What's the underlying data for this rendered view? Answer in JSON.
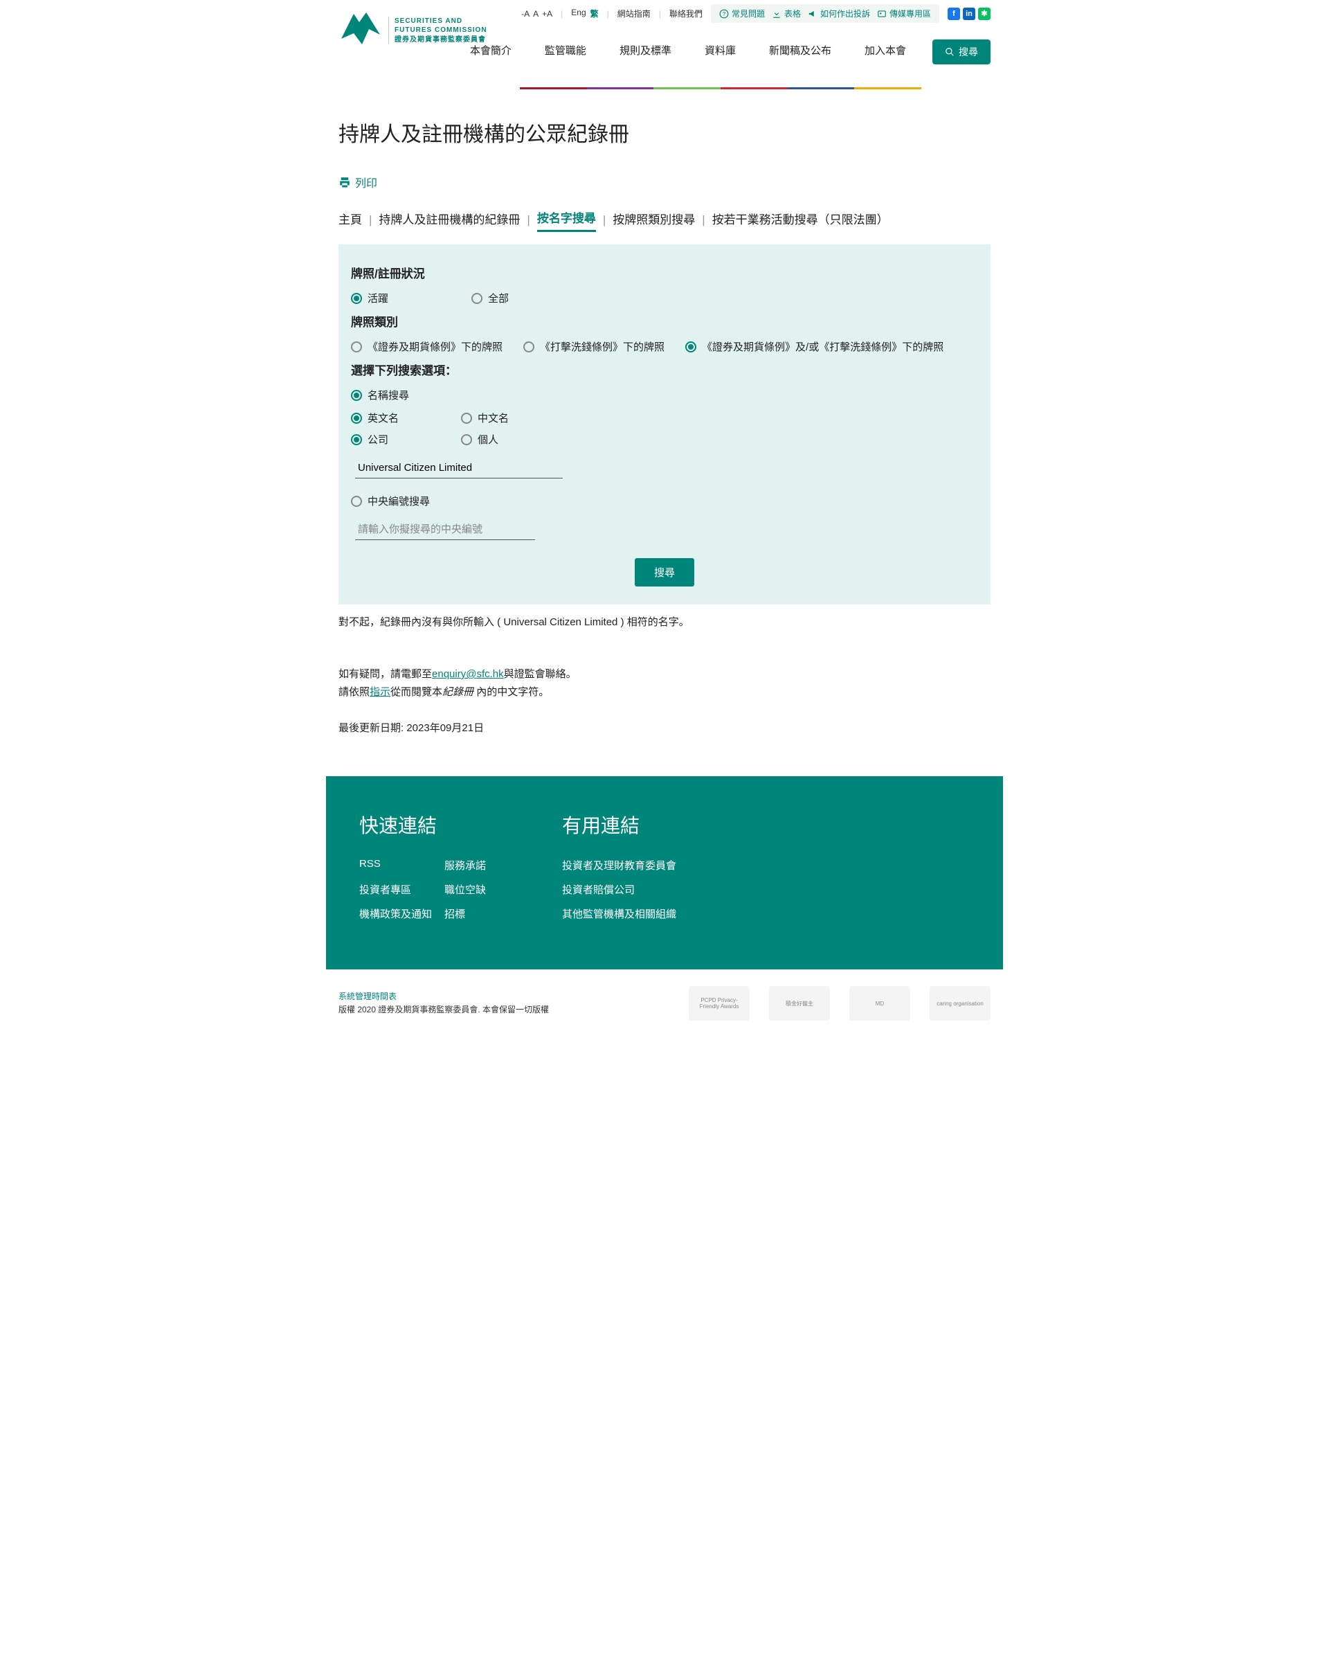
{
  "top": {
    "font_minus": "-A",
    "font_a": "A",
    "font_plus": "+A",
    "lang_en": "Eng",
    "lang_zh": "繁",
    "sitemap": "網站指南",
    "contact": "聯絡我們",
    "faq": "常見問題",
    "forms": "表格",
    "complaint": "如何作出投訴",
    "media": "傳媒專用區"
  },
  "logo": {
    "l1": "SECURITIES AND",
    "l2": "FUTURES COMMISSION",
    "l3": "證券及期貨事務監察委員會"
  },
  "nav": [
    "本會簡介",
    "監管職能",
    "規則及標準",
    "資料庫",
    "新聞稿及公布",
    "加入本會"
  ],
  "search_btn": "搜尋",
  "page_title": "持牌人及註冊機構的公眾紀錄冊",
  "print": "列印",
  "tabs": {
    "home": "主頁",
    "register": "持牌人及註冊機構的紀錄冊",
    "by_name": "按名字搜尋",
    "by_type": "按牌照類別搜尋",
    "by_act": "按若干業務活動搜尋（只限法團）"
  },
  "form": {
    "h_status": "牌照/註冊狀況",
    "status_active": "活躍",
    "status_all": "全部",
    "h_type": "牌照類別",
    "type_sfo": "《證券及期貨條例》下的牌照",
    "type_amlo": "《打擊洗錢條例》下的牌照",
    "type_both": "《證券及期貨條例》及/或《打擊洗錢條例》下的牌照",
    "h_option": "選擇下列搜索選項：",
    "opt_name": "名稱搜尋",
    "lang_en": "英文名",
    "lang_zh": "中文名",
    "ent_corp": "公司",
    "ent_ind": "個人",
    "name_value": "Universal Citizen Limited",
    "opt_ce": "中央編號搜尋",
    "ce_placeholder": "請輸入你擬搜尋的中央編號",
    "submit": "搜尋"
  },
  "result": {
    "prefix": "對不起，紀錄冊內沒有與你所輸入 ( ",
    "term": "Universal Citizen Limited",
    "suffix": " ) 相符的名字。"
  },
  "contact": {
    "l1a": "如有疑問，請電郵至",
    "email": "enquiry@sfc.hk",
    "l1b": "與證監會聯絡。",
    "l2a": "請依照",
    "link": "指示",
    "l2b": "從而閱覽本",
    "em": "紀錄冊",
    "l2c": " 內的中文字符。"
  },
  "updated_label": "最後更新日期: ",
  "updated_value": "2023年09月21日",
  "footer": {
    "h_quick": "快速連結",
    "h_useful": "有用連結",
    "quick": [
      "RSS",
      "服務承諾",
      "投資者專區",
      "職位空缺",
      "機構政策及通知",
      "招標"
    ],
    "useful": [
      "投資者及理財教育委員會",
      "投資者賠償公司",
      "其他監管機構及相關組織"
    ]
  },
  "bottom": {
    "housekeeping": "系統管理時間表",
    "copyright": "版權 2020 證券及期貨事務監察委員會. 本會保留一切版權"
  }
}
